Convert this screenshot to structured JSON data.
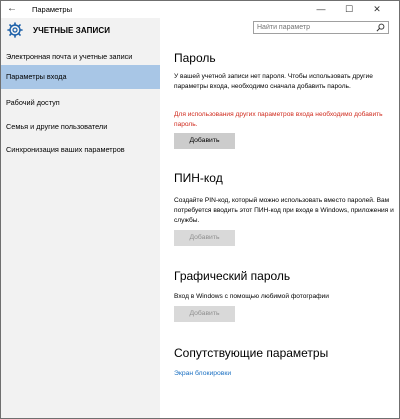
{
  "window": {
    "title": "Параметры",
    "controls": {
      "minimize": "—",
      "maximize": "☐",
      "close": "✕"
    },
    "back_glyph": "←"
  },
  "sidebar": {
    "title": "УЧЕТНЫЕ ЗАПИСИ",
    "items": [
      {
        "label": "Электронная почта и учетные записи",
        "active": false
      },
      {
        "label": "Параметры входа",
        "active": true
      },
      {
        "label": "Рабочий доступ",
        "active": false
      },
      {
        "label": "Семья и другие пользователи",
        "active": false
      },
      {
        "label": "Синхронизация ваших параметров",
        "active": false
      }
    ]
  },
  "search": {
    "placeholder": "Найти параметр"
  },
  "sections": {
    "password": {
      "title": "Пароль",
      "description": "У вашей учетной записи нет пароля. Чтобы использовать другие параметры входа, необходимо сначала добавить пароль.",
      "warning": "Для использования других параметров входа необходимо добавить пароль.",
      "button": "Добавить"
    },
    "pin": {
      "title": "ПИН-код",
      "description": "Создайте PIN-код, который можно использовать вместо паролей. Вам потребуется вводить этот ПИН-код при входе в Windows, приложения и службы.",
      "button": "Добавить"
    },
    "picture": {
      "title": "Графический пароль",
      "description": "Вход в Windows с помощью любимой фотографии",
      "button": "Добавить"
    },
    "related": {
      "title": "Сопутствующие параметры",
      "link": "Экран блокировки"
    }
  },
  "colors": {
    "accent": "#a8c6e6",
    "warning": "#d02b1e",
    "link": "#1b70c2",
    "sidebar_bg": "#f2f2f2"
  }
}
